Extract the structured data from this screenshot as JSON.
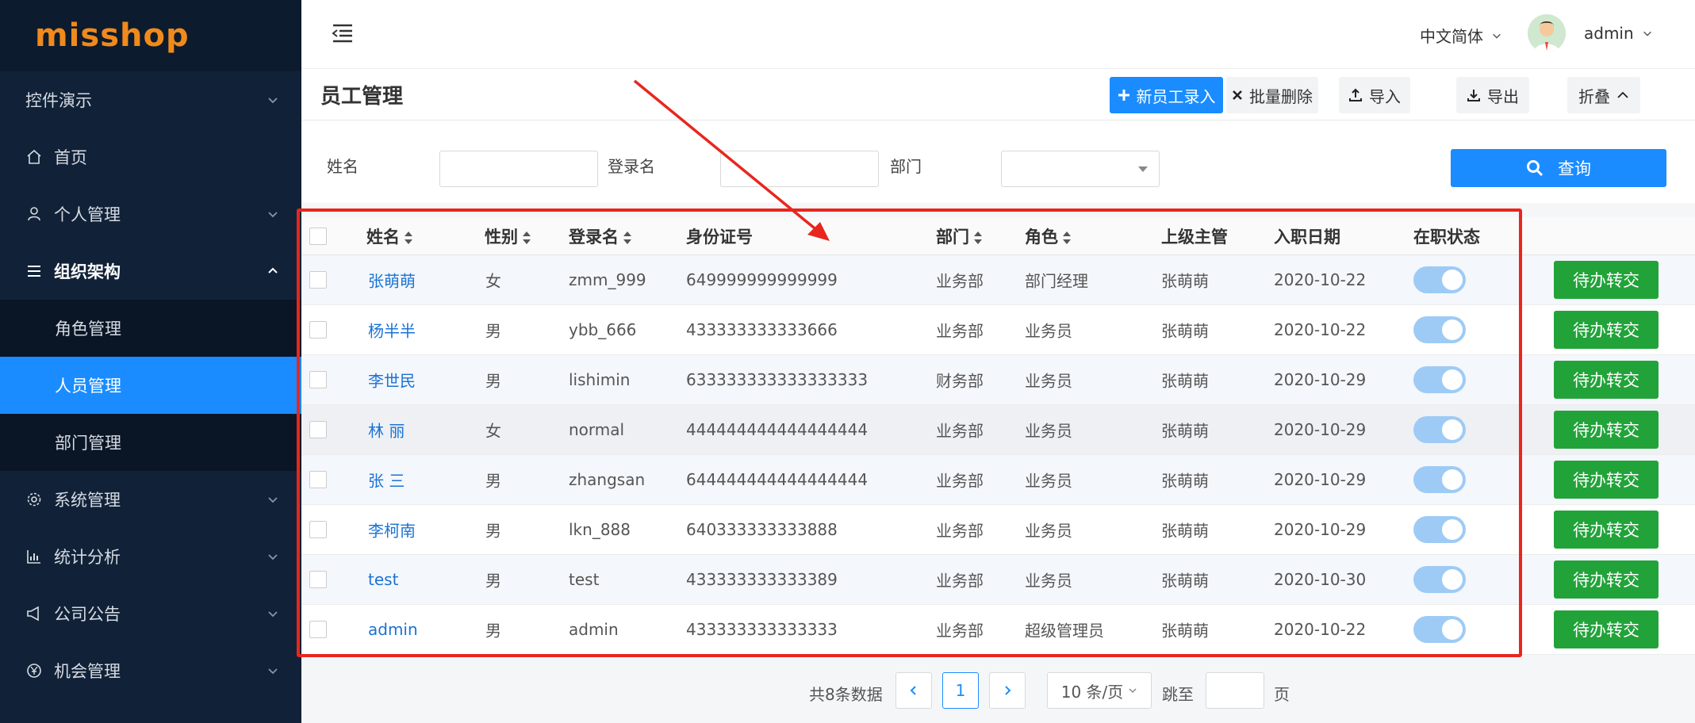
{
  "logo": "misshop",
  "sidebar": {
    "items": [
      {
        "label": "控件演示",
        "icon": "none",
        "arrow": "down"
      },
      {
        "label": "首页",
        "icon": "home-icon"
      },
      {
        "label": "个人管理",
        "icon": "user-icon",
        "arrow": "down"
      },
      {
        "label": "组织架构",
        "icon": "list-icon",
        "arrow": "up"
      },
      {
        "label": "系统管理",
        "icon": "gear-icon",
        "arrow": "down"
      },
      {
        "label": "统计分析",
        "icon": "chart-icon",
        "arrow": "down"
      },
      {
        "label": "公司公告",
        "icon": "megaphone-icon",
        "arrow": "down"
      },
      {
        "label": "机会管理",
        "icon": "yen-icon",
        "arrow": "down"
      }
    ],
    "submenu": [
      {
        "label": "角色管理"
      },
      {
        "label": "人员管理",
        "active": true
      },
      {
        "label": "部门管理"
      }
    ]
  },
  "topbar": {
    "language": "中文简体",
    "username": "admin"
  },
  "page": {
    "title": "员工管理",
    "actions": {
      "new_label": "新员工录入",
      "batch_delete_label": "批量删除",
      "import_label": "导入",
      "export_label": "导出",
      "collapse_label": "折叠"
    }
  },
  "filter": {
    "name_label": "姓名",
    "login_label": "登录名",
    "dept_label": "部门",
    "query_label": "查询"
  },
  "table": {
    "headers": {
      "name": "姓名",
      "gender": "性别",
      "login": "登录名",
      "id_number": "身份证号",
      "dept": "部门",
      "role": "角色",
      "manager": "上级主管",
      "date": "入职日期",
      "status": "在职状态"
    },
    "action_label": "待办转交",
    "rows": [
      {
        "name": "张萌萌",
        "gender": "女",
        "login": "zmm_999",
        "id_number": "649999999999999",
        "dept": "业务部",
        "role": "部门经理",
        "manager": "张萌萌",
        "date": "2020-10-22",
        "active": true
      },
      {
        "name": "杨半半",
        "gender": "男",
        "login": "ybb_666",
        "id_number": "433333333333666",
        "dept": "业务部",
        "role": "业务员",
        "manager": "张萌萌",
        "date": "2020-10-22",
        "active": true
      },
      {
        "name": "李世民",
        "gender": "男",
        "login": "lishimin",
        "id_number": "633333333333333333",
        "dept": "财务部",
        "role": "业务员",
        "manager": "张萌萌",
        "date": "2020-10-29",
        "active": true
      },
      {
        "name": "林 丽",
        "gender": "女",
        "login": "normal",
        "id_number": "444444444444444444",
        "dept": "业务部",
        "role": "业务员",
        "manager": "张萌萌",
        "date": "2020-10-29",
        "active": true
      },
      {
        "name": "张 三",
        "gender": "男",
        "login": "zhangsan",
        "id_number": "644444444444444444",
        "dept": "业务部",
        "role": "业务员",
        "manager": "张萌萌",
        "date": "2020-10-29",
        "active": true
      },
      {
        "name": "李柯南",
        "gender": "男",
        "login": "lkn_888",
        "id_number": "640333333333888",
        "dept": "业务部",
        "role": "业务员",
        "manager": "张萌萌",
        "date": "2020-10-29",
        "active": true
      },
      {
        "name": "test",
        "gender": "男",
        "login": "test",
        "id_number": "433333333333389",
        "dept": "业务部",
        "role": "业务员",
        "manager": "张萌萌",
        "date": "2020-10-30",
        "active": true
      },
      {
        "name": "admin",
        "gender": "男",
        "login": "admin",
        "id_number": "433333333333333",
        "dept": "业务部",
        "role": "超级管理员",
        "manager": "张萌萌",
        "date": "2020-10-22",
        "active": true
      }
    ]
  },
  "pager": {
    "total": "共8条数据",
    "current": "1",
    "page_size": "10 条/页",
    "goto_label": "跳至",
    "page_suffix": "页"
  },
  "colors": {
    "sidebar_bg": "#112238",
    "accent": "#1a8cff",
    "logo": "#f08a1c",
    "action_green": "#22a33a",
    "annotation_red": "#e8261e"
  }
}
